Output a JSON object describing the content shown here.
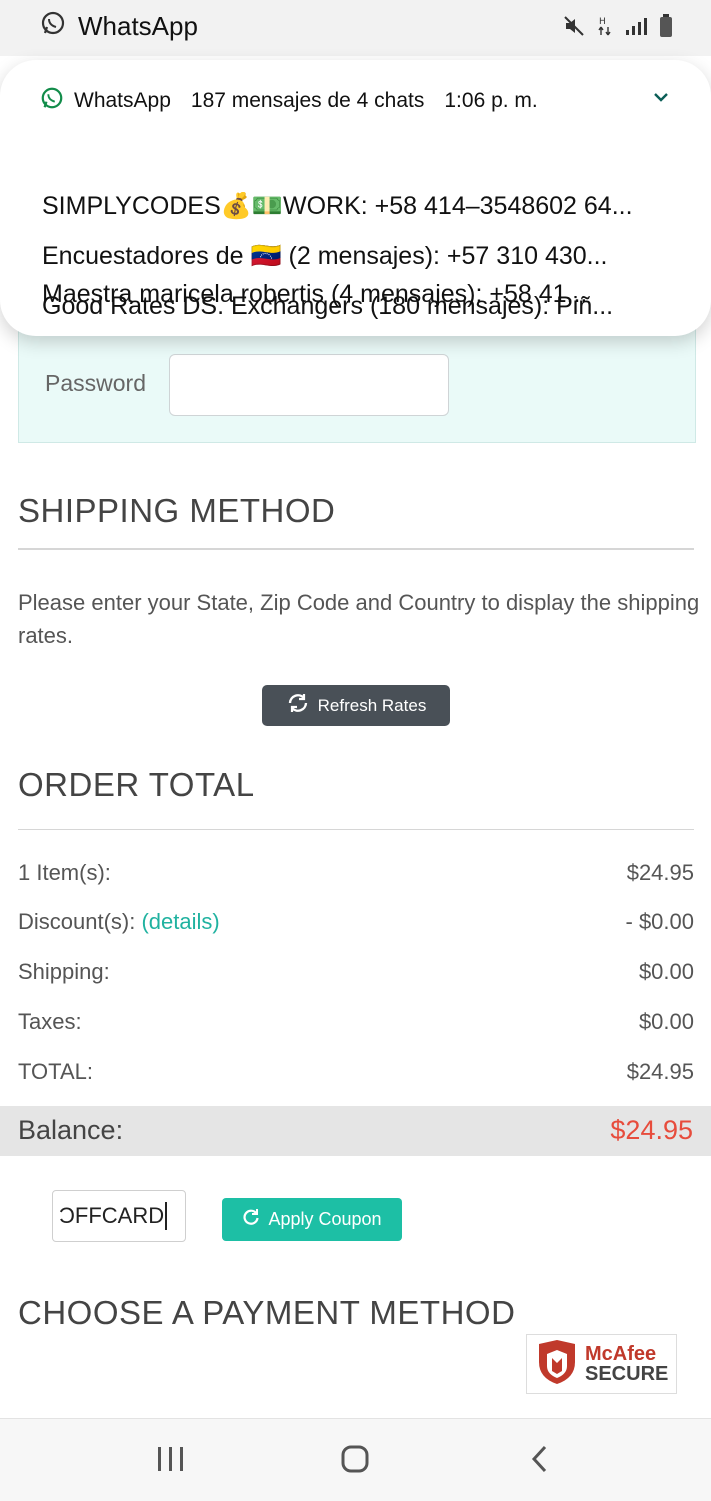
{
  "status_bar": {
    "app_name": "WhatsApp",
    "icons": [
      "whatsapp-icon",
      "mute-icon",
      "data-icon",
      "signal-icon",
      "battery-icon"
    ]
  },
  "notification": {
    "app_name": "WhatsApp",
    "summary": "187 mensajes de 4 chats",
    "time": "1:06 p. m.",
    "lines": [
      "SIMPLYCODES💰💵WORK: +58 414‒3548602  64...",
      "Encuestadores de 🇻🇪 (2 mensajes): +57 310 430...",
      "Good Rates DS. Exchangers (180 mensajes): Piñ...",
      "Maestra maricela robertis (4 mensajes): +58 41..."
    ]
  },
  "login": {
    "password_label": "Password",
    "password_value": ""
  },
  "shipping": {
    "heading": "SHIPPING METHOD",
    "description": "Please enter your State, Zip Code and Country to display the shipping rates.",
    "refresh_label": "Refresh Rates"
  },
  "order_total": {
    "heading": "ORDER TOTAL",
    "items_label": "1 Item(s):",
    "items_value": "$24.95",
    "discount_label": "Discount(s):",
    "discount_link": "(details)",
    "discount_value": "- $0.00",
    "shipping_label": "Shipping:",
    "shipping_value": "$0.00",
    "taxes_label": "Taxes:",
    "taxes_value": "$0.00",
    "total_label": "TOTAL:",
    "total_value": "$24.95",
    "balance_label": "Balance:",
    "balance_value": "$24.95",
    "balance_color": "#e74c3c"
  },
  "coupon": {
    "value": "ƆFFCARD",
    "apply_label": "Apply Coupon"
  },
  "payment": {
    "heading": "CHOOSE A PAYMENT METHOD",
    "badge_line1": "McAfee",
    "badge_line2": "SECURE"
  },
  "colors": {
    "accent": "#1dbfa5",
    "button_dark": "#495057",
    "balance_red": "#e74c3c"
  }
}
